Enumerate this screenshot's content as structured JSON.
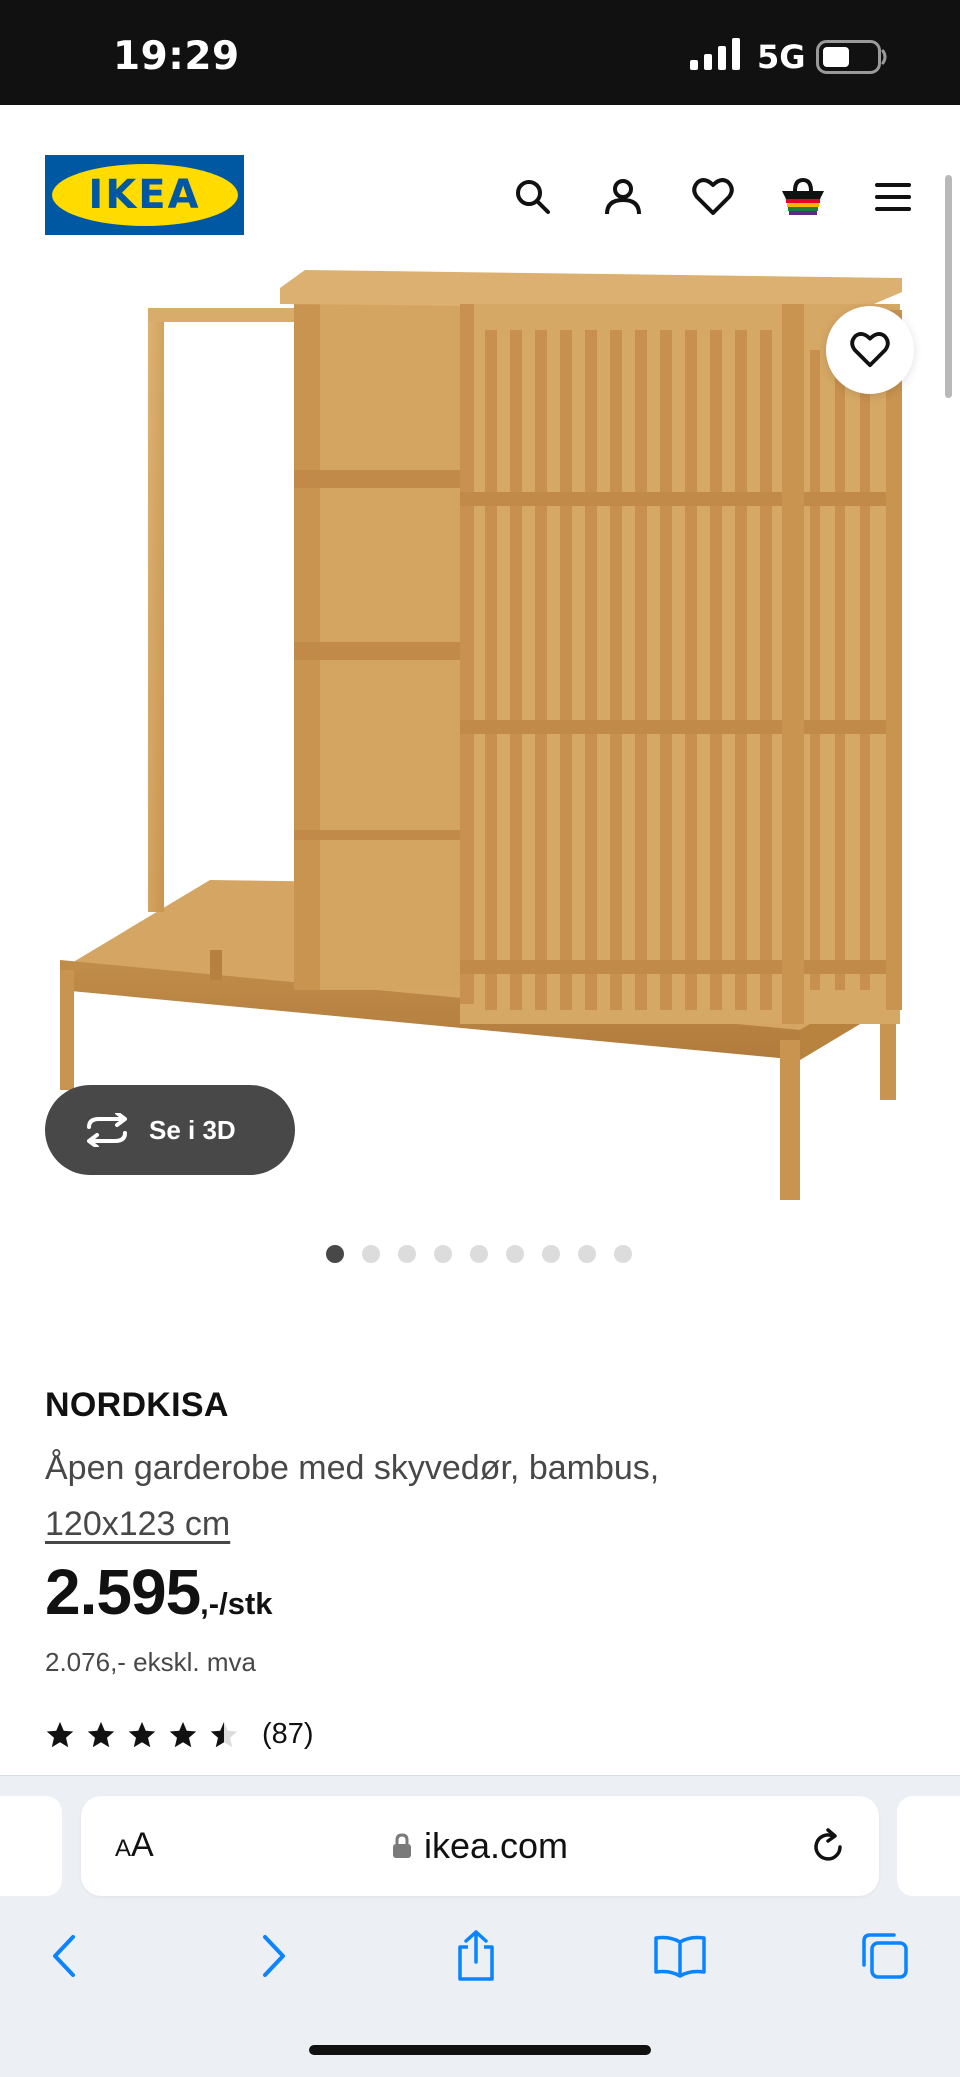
{
  "status_bar": {
    "time": "19:29",
    "network": "5G",
    "signal_icon": "signal-bars-icon",
    "battery_icon": "battery-icon"
  },
  "header": {
    "logo_text": "IKEA",
    "icons": [
      "search-icon",
      "user-icon",
      "heart-icon",
      "basket-icon",
      "menu-icon"
    ],
    "brand_blue": "#0058a3",
    "brand_yellow": "#ffdb00"
  },
  "gallery": {
    "view_3d_label": "Se i 3D",
    "dot_count": 9,
    "active_dot": 1
  },
  "product": {
    "name": "NORDKISA",
    "description": "Åpen garderobe med skyvedør, bambus,",
    "dimensions": "120x123 cm",
    "price": "2.595",
    "price_suffix": ",-/stk",
    "price_ex_vat": "2.076,- ekskl. mva",
    "rating_value": 4.5,
    "rating_count": "(87)"
  },
  "browser": {
    "text_size_label_small": "A",
    "text_size_label_large": "A",
    "url": "ikea.com",
    "toolbar_icons": [
      "back-icon",
      "forward-icon",
      "share-icon",
      "bookmarks-icon",
      "tabs-icon"
    ],
    "accent": "#0a84ff"
  }
}
